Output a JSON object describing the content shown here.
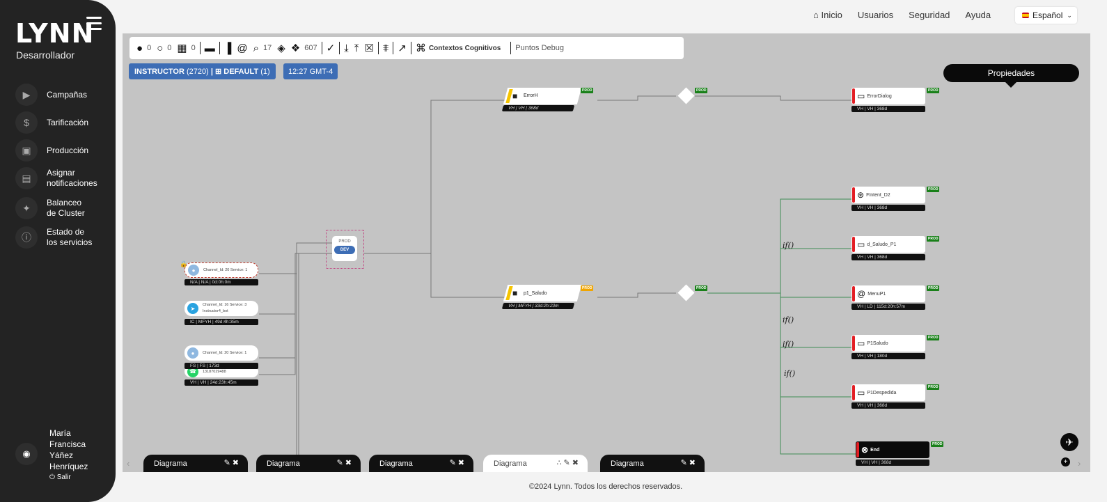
{
  "sidebar": {
    "logo": "LYNN",
    "role": "Desarrollador",
    "items": [
      {
        "label": "Campañas",
        "icon": "megaphone-icon"
      },
      {
        "label": "Tarificación",
        "icon": "dollar-icon"
      },
      {
        "label": "Producción",
        "icon": "briefcase-icon"
      },
      {
        "label": "Asignar notificaciones",
        "icon": "notification-icon"
      },
      {
        "label": "Balanceo de Cluster",
        "icon": "cluster-icon"
      },
      {
        "label": "Estado de los servicios",
        "icon": "info-icon"
      }
    ],
    "user": {
      "name": "María Francisca Yáñez Henríquez",
      "logout": "Salir"
    }
  },
  "topnav": {
    "items": [
      "Inicio",
      "Usuarios",
      "Seguridad",
      "Ayuda"
    ],
    "language": "Español"
  },
  "toolbar": {
    "users": "0",
    "messages": "0",
    "calendar": "0",
    "search": "17",
    "plugins": "607",
    "contexts": "Contextos Cognitivos",
    "debug": "Puntos Debug"
  },
  "badges": {
    "instructor": "INSTRUCTOR",
    "instructor_id": "(2720)",
    "default": "DEFAULT",
    "default_id": "(1)",
    "time": "12:27 GMT-4"
  },
  "properties": "Propiedades",
  "nodes": {
    "errorh": {
      "label": "ErrorH",
      "sub": "VH | VH | 368d",
      "tag": "PROD"
    },
    "p1saludo": {
      "label": "p1_Saludo",
      "sub": "VH | MFYH | 33d:2h:23m",
      "tag": "PROD"
    },
    "errordialog": {
      "label": "ErrorDialog",
      "sub": "VH | VH | 368d",
      "tag": "PROD"
    },
    "fintent": {
      "label": "FIntent_D2",
      "sub": "VH | VH | 368d",
      "tag": "PROD"
    },
    "dsaludo": {
      "label": "d_Saludo_P1",
      "sub": "VH | VH | 368d",
      "tag": "PROD"
    },
    "menup1": {
      "label": "MenuP1",
      "sub": "VH | LD | 115d:20h:57m",
      "tag": "PROD"
    },
    "p1saludo2": {
      "label": "P1Saludo",
      "sub": "VH | VH | 180d",
      "tag": "PROD"
    },
    "p1despedida": {
      "label": "P1Despedida",
      "sub": "VH | VH | 368d",
      "tag": "PROD"
    },
    "end": {
      "label": "End",
      "sub": "VH | VH | 368d",
      "tag": "PROD"
    },
    "diamond_tag": "PROD",
    "env_prod": "PROD",
    "env_dev": "DEV",
    "if_label": "if()"
  },
  "channels": [
    {
      "title": "Channel_Id: 20 Service: 1",
      "detail": "",
      "sub": "N/A | N/A | 0d:0h:0m"
    },
    {
      "title": "Channel_Id: 16 Service: 3",
      "detail": "Instructor4_bot",
      "sub": "IC | MFYH | 49d:4h:35m"
    },
    {
      "title": "Channel_Id: 20 Service: 1",
      "detail": "",
      "sub": "FS | FS | 173d"
    },
    {
      "title": "",
      "detail": "13187029488",
      "sub": "VH | VH | 24d:23h:45m"
    }
  ],
  "tabs": [
    "Diagrama",
    "Diagrama",
    "Diagrama",
    "Diagrama",
    "Diagrama"
  ],
  "footer": "©2024 Lynn. Todos los derechos reservados."
}
